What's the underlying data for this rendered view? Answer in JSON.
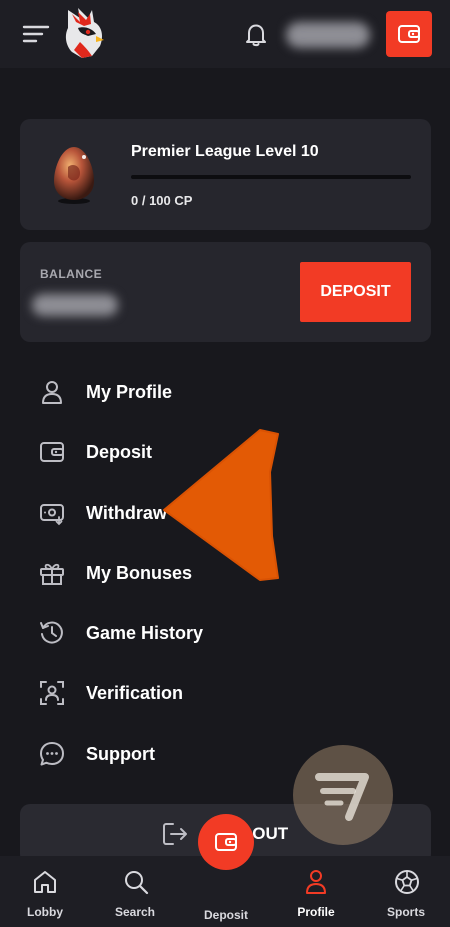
{
  "header": {
    "menu_icon": "hamburger-icon",
    "logo_icon": "rooster-logo-icon",
    "notification_icon": "bell-icon",
    "wallet_icon": "wallet-icon",
    "accent_color": "#f23b25"
  },
  "level": {
    "title": "Premier League Level 10",
    "progress_text": "0 / 100 CP",
    "progress_fraction": 0
  },
  "balance": {
    "label": "BALANCE",
    "deposit_label": "DEPOSIT"
  },
  "menu": {
    "items": [
      {
        "label": "My Profile",
        "icon": "user-icon"
      },
      {
        "label": "Deposit",
        "icon": "wallet-icon"
      },
      {
        "label": "Withdraw",
        "icon": "withdraw-icon"
      },
      {
        "label": "My Bonuses",
        "icon": "gift-icon"
      },
      {
        "label": "Game History",
        "icon": "history-icon"
      },
      {
        "label": "Verification",
        "icon": "verification-icon"
      },
      {
        "label": "Support",
        "icon": "chat-icon"
      }
    ]
  },
  "signout": {
    "label": "SIGN OUT",
    "icon": "sign-out-icon"
  },
  "bottom_nav": {
    "items": [
      {
        "label": "Lobby",
        "icon": "home-icon"
      },
      {
        "label": "Search",
        "icon": "search-icon"
      },
      {
        "label": "Deposit",
        "icon": "wallet-icon"
      },
      {
        "label": "Profile",
        "icon": "user-icon",
        "active": true
      },
      {
        "label": "Sports",
        "icon": "soccer-ball-icon"
      }
    ]
  }
}
